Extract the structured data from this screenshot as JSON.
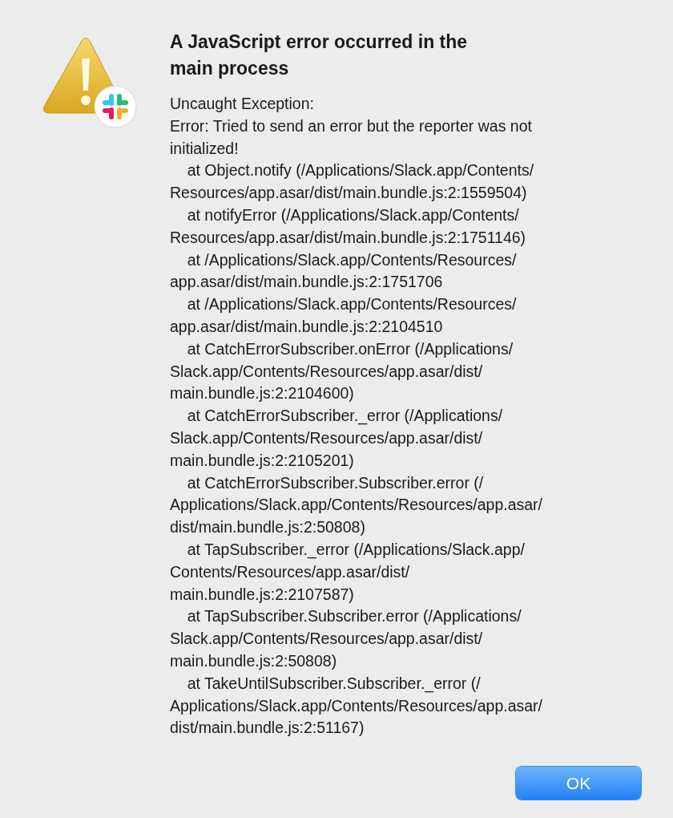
{
  "dialog": {
    "title_lines": [
      "A JavaScript error occurred in the",
      "main process"
    ],
    "message_lines": [
      "Uncaught Exception:",
      "Error: Tried to send an error but the reporter was not",
      "initialized!",
      "    at Object.notify (/Applications/Slack.app/Contents/",
      "Resources/app.asar/dist/main.bundle.js:2:1559504)",
      "    at notifyError (/Applications/Slack.app/Contents/",
      "Resources/app.asar/dist/main.bundle.js:2:1751146)",
      "    at /Applications/Slack.app/Contents/Resources/",
      "app.asar/dist/main.bundle.js:2:1751706",
      "    at /Applications/Slack.app/Contents/Resources/",
      "app.asar/dist/main.bundle.js:2:2104510",
      "    at CatchErrorSubscriber.onError (/Applications/",
      "Slack.app/Contents/Resources/app.asar/dist/",
      "main.bundle.js:2:2104600)",
      "    at CatchErrorSubscriber._error (/Applications/",
      "Slack.app/Contents/Resources/app.asar/dist/",
      "main.bundle.js:2:2105201)",
      "    at CatchErrorSubscriber.Subscriber.error (/",
      "Applications/Slack.app/Contents/Resources/app.asar/",
      "dist/main.bundle.js:2:50808)",
      "    at TapSubscriber._error (/Applications/Slack.app/",
      "Contents/Resources/app.asar/dist/",
      "main.bundle.js:2:2107587)",
      "    at TapSubscriber.Subscriber.error (/Applications/",
      "Slack.app/Contents/Resources/app.asar/dist/",
      "main.bundle.js:2:50808)",
      "    at TakeUntilSubscriber.Subscriber._error (/",
      "Applications/Slack.app/Contents/Resources/app.asar/",
      "dist/main.bundle.js:2:51167)"
    ],
    "button": "OK"
  }
}
